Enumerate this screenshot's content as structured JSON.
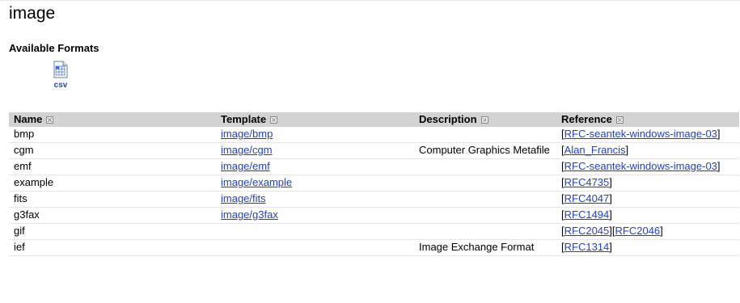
{
  "page": {
    "title": "image",
    "section_heading": "Available Formats",
    "formats": [
      {
        "label": "csv",
        "icon": "spreadsheet-icon"
      }
    ]
  },
  "table": {
    "headers": [
      "Name",
      "Template",
      "Description",
      "Reference"
    ],
    "rows": [
      {
        "name": "bmp",
        "template": "image/bmp",
        "description": "",
        "refs": [
          "RFC-seantek-windows-image-03"
        ]
      },
      {
        "name": "cgm",
        "template": "image/cgm",
        "description": "Computer Graphics Metafile",
        "refs": [
          "Alan_Francis"
        ]
      },
      {
        "name": "emf",
        "template": "image/emf",
        "description": "",
        "refs": [
          "RFC-seantek-windows-image-03"
        ]
      },
      {
        "name": "example",
        "template": "image/example",
        "description": "",
        "refs": [
          "RFC4735"
        ]
      },
      {
        "name": "fits",
        "template": "image/fits",
        "description": "",
        "refs": [
          "RFC4047"
        ]
      },
      {
        "name": "g3fax",
        "template": "image/g3fax",
        "description": "",
        "refs": [
          "RFC1494"
        ]
      },
      {
        "name": "gif",
        "template": "",
        "description": "",
        "refs": [
          "RFC2045",
          "RFC2046"
        ]
      },
      {
        "name": "ief",
        "template": "",
        "description": "Image Exchange Format",
        "refs": [
          "RFC1314"
        ]
      }
    ]
  }
}
